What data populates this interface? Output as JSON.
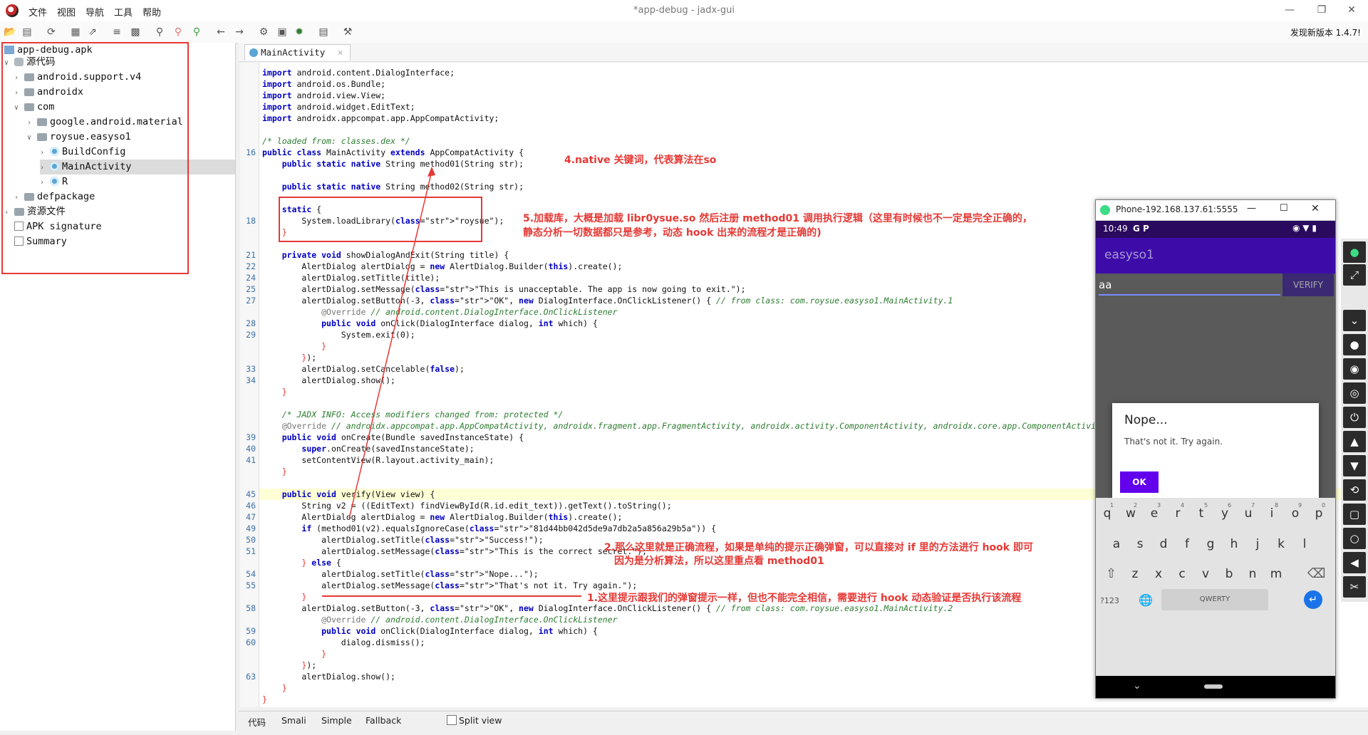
{
  "window": {
    "title": "*app-debug - jadx-gui",
    "menu": [
      "文件",
      "视图",
      "导航",
      "工具",
      "帮助"
    ],
    "update_notice": "发现新版本 1.4.7!"
  },
  "tree": {
    "root": "app-debug.apk",
    "source": "源代码",
    "pkg1": "android.support.v4",
    "pkg2": "androidx",
    "pkg3": "com",
    "pkg4": "google.android.material",
    "pkg5": "roysue.easyso1",
    "cls1": "BuildConfig",
    "cls2": "MainActivity",
    "cls3": "R",
    "pkg6": "defpackage",
    "resources": "资源文件",
    "apk_sig": "APK signature",
    "summary": "Summary"
  },
  "editor": {
    "tab": "MainActivity",
    "lines": [
      {
        "n": "",
        "t": "import android.content.DialogInterface;"
      },
      {
        "n": "",
        "t": "import android.os.Bundle;"
      },
      {
        "n": "",
        "t": "import android.view.View;"
      },
      {
        "n": "",
        "t": "import android.widget.EditText;"
      },
      {
        "n": "",
        "t": "import androidx.appcompat.app.AppCompatActivity;"
      },
      {
        "n": "",
        "t": ""
      },
      {
        "n": "",
        "t": "/* loaded from: classes.dex */"
      },
      {
        "n": "16",
        "t": "public class MainActivity extends AppCompatActivity {"
      },
      {
        "n": "",
        "t": "    public static native String method01(String str);"
      },
      {
        "n": "",
        "t": ""
      },
      {
        "n": "",
        "t": "    public static native String method02(String str);"
      },
      {
        "n": "",
        "t": ""
      },
      {
        "n": "",
        "t": "    static {"
      },
      {
        "n": "18",
        "t": "        System.loadLibrary(\"roysue\");"
      },
      {
        "n": "",
        "t": "    }"
      },
      {
        "n": "",
        "t": ""
      },
      {
        "n": "21",
        "t": "    private void showDialogAndExit(String title) {"
      },
      {
        "n": "22",
        "t": "        AlertDialog alertDialog = new AlertDialog.Builder(this).create();"
      },
      {
        "n": "24",
        "t": "        alertDialog.setTitle(title);"
      },
      {
        "n": "25",
        "t": "        alertDialog.setMessage(\"This is unacceptable. The app is now going to exit.\");"
      },
      {
        "n": "27",
        "t": "        alertDialog.setButton(-3, \"OK\", new DialogInterface.OnClickListener() { // from class: com.roysue.easyso1.MainActivity.1"
      },
      {
        "n": "",
        "t": "            @Override // android.content.DialogInterface.OnClickListener"
      },
      {
        "n": "28",
        "t": "            public void onClick(DialogInterface dialog, int which) {"
      },
      {
        "n": "29",
        "t": "                System.exit(0);"
      },
      {
        "n": "",
        "t": "            }"
      },
      {
        "n": "",
        "t": "        });"
      },
      {
        "n": "33",
        "t": "        alertDialog.setCancelable(false);"
      },
      {
        "n": "34",
        "t": "        alertDialog.show();"
      },
      {
        "n": "",
        "t": "    }"
      },
      {
        "n": "",
        "t": ""
      },
      {
        "n": "",
        "t": "    /* JADX INFO: Access modifiers changed from: protected */"
      },
      {
        "n": "",
        "t": "    @Override // androidx.appcompat.app.AppCompatActivity, androidx.fragment.app.FragmentActivity, androidx.activity.ComponentActivity, androidx.core.app.ComponentActivity"
      },
      {
        "n": "39",
        "t": "    public void onCreate(Bundle savedInstanceState) {"
      },
      {
        "n": "40",
        "t": "        super.onCreate(savedInstanceState);"
      },
      {
        "n": "41",
        "t": "        setContentView(R.layout.activity_main);"
      },
      {
        "n": "",
        "t": "    }"
      },
      {
        "n": "",
        "t": ""
      },
      {
        "n": "45",
        "t": "    public void verify(View view) {"
      },
      {
        "n": "46",
        "t": "        String v2 = ((EditText) findViewById(R.id.edit_text)).getText().toString();"
      },
      {
        "n": "47",
        "t": "        AlertDialog alertDialog = new AlertDialog.Builder(this).create();"
      },
      {
        "n": "49",
        "t": "        if (method01(v2).equalsIgnoreCase(\"81d44bb042d5de9a7db2a5a856a29b5a\")) {"
      },
      {
        "n": "50",
        "t": "            alertDialog.setTitle(\"Success!\");"
      },
      {
        "n": "51",
        "t": "            alertDialog.setMessage(\"This is the correct secret.\");"
      },
      {
        "n": "",
        "t": "        } else {"
      },
      {
        "n": "54",
        "t": "            alertDialog.setTitle(\"Nope...\");"
      },
      {
        "n": "55",
        "t": "            alertDialog.setMessage(\"That's not it. Try again.\");"
      },
      {
        "n": "",
        "t": "        }"
      },
      {
        "n": "58",
        "t": "        alertDialog.setButton(-3, \"OK\", new DialogInterface.OnClickListener() { // from class: com.roysue.easyso1.MainActivity.2"
      },
      {
        "n": "",
        "t": "            @Override // android.content.DialogInterface.OnClickListener"
      },
      {
        "n": "59",
        "t": "            public void onClick(DialogInterface dialog, int which) {"
      },
      {
        "n": "60",
        "t": "                dialog.dismiss();"
      },
      {
        "n": "",
        "t": "            }"
      },
      {
        "n": "",
        "t": "        });"
      },
      {
        "n": "63",
        "t": "        alertDialog.show();"
      },
      {
        "n": "",
        "t": "    }"
      },
      {
        "n": "",
        "t": "}"
      }
    ]
  },
  "annotations": {
    "a4": "4.native 关键词，代表算法在so",
    "a5_line1": "5.加载库，大概是加载 libr0ysue.so 然后注册 method01 调用执行逻辑（这里有时候也不一定是完全正确的，",
    "a5_line2": "静态分析一切数据都只是参考，动态 hook 出来的流程才是正确的)",
    "a2_line1": "2.那么这里就是正确流程，如果是单纯的提示正确弹窗，可以直接对 if 里的方法进行 hook 即可",
    "a2_line2": "因为是分析算法，所以这里重点看 method01",
    "a1": "1.这里提示跟我们的弹窗提示一样，但也不能完全相信，需要进行 hook 动态验证是否执行该流程"
  },
  "bottom_tabs": [
    "代码",
    "Smali",
    "Simple",
    "Fallback"
  ],
  "split_view": "Split view",
  "phone": {
    "window_title": "Phone-192.168.137.61:5555",
    "time": "10:49",
    "status_icons": "G P",
    "app_title": "easyso1",
    "input_value": "aa",
    "verify_label": "VERIFY",
    "dialog_title": "Nope...",
    "dialog_message": "That's not it. Try again.",
    "ok_label": "OK",
    "row1": [
      "q",
      "w",
      "e",
      "r",
      "t",
      "y",
      "u",
      "i",
      "o",
      "p"
    ],
    "row1_hints": [
      "1",
      "2",
      "3",
      "4",
      "5",
      "6",
      "7",
      "8",
      "9",
      "0"
    ],
    "row2": [
      "a",
      "s",
      "d",
      "f",
      "g",
      "h",
      "j",
      "k",
      "l"
    ],
    "row3": [
      "z",
      "x",
      "c",
      "v",
      "b",
      "n",
      "m"
    ],
    "key_123": "?123",
    "space_label": "QWERTY"
  },
  "colors": {
    "accent_red": "#e53935",
    "app_purple": "#3d0ca8",
    "ok_purple": "#6200ee"
  }
}
